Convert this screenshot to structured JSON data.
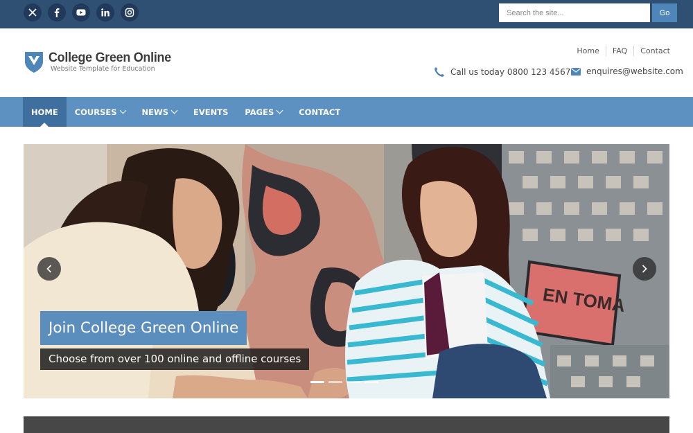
{
  "topbar": {
    "social": [
      {
        "icon": "x-icon",
        "name": "X"
      },
      {
        "icon": "facebook-icon",
        "name": "Facebook"
      },
      {
        "icon": "youtube-icon",
        "name": "YouTube"
      },
      {
        "icon": "linkedin-icon",
        "name": "LinkedIn"
      },
      {
        "icon": "instagram-icon",
        "name": "Instagram"
      }
    ],
    "search_placeholder": "Search the site...",
    "search_value": "",
    "search_button": "Go"
  },
  "header": {
    "logo_title": "College Green Online",
    "logo_tagline": "Website Template for Education",
    "links": [
      "Home",
      "FAQ",
      "Contact"
    ],
    "phone": "Call us today 0800 123 4567",
    "email": "enquires@website.com"
  },
  "nav": {
    "items": [
      {
        "label": "HOME",
        "active": true,
        "dropdown": false
      },
      {
        "label": "COURSES",
        "active": false,
        "dropdown": true
      },
      {
        "label": "NEWS",
        "active": false,
        "dropdown": true
      },
      {
        "label": "EVENTS",
        "active": false,
        "dropdown": false
      },
      {
        "label": "PAGES",
        "active": false,
        "dropdown": true
      },
      {
        "label": "CONTACT",
        "active": false,
        "dropdown": false
      }
    ]
  },
  "hero": {
    "caption_title": "Join College Green Online",
    "caption_subtitle": "Choose from over 100 online and offline courses",
    "graffiti_text": "EN TOMA",
    "slides": 4,
    "active_slide": 1
  },
  "colors": {
    "topbar": "#2f4f73",
    "nav": "#5d91c2",
    "nav_active": "#3f6f9f",
    "accent": "#4f86ba",
    "caption_title_bg": "#5b8dbd"
  }
}
